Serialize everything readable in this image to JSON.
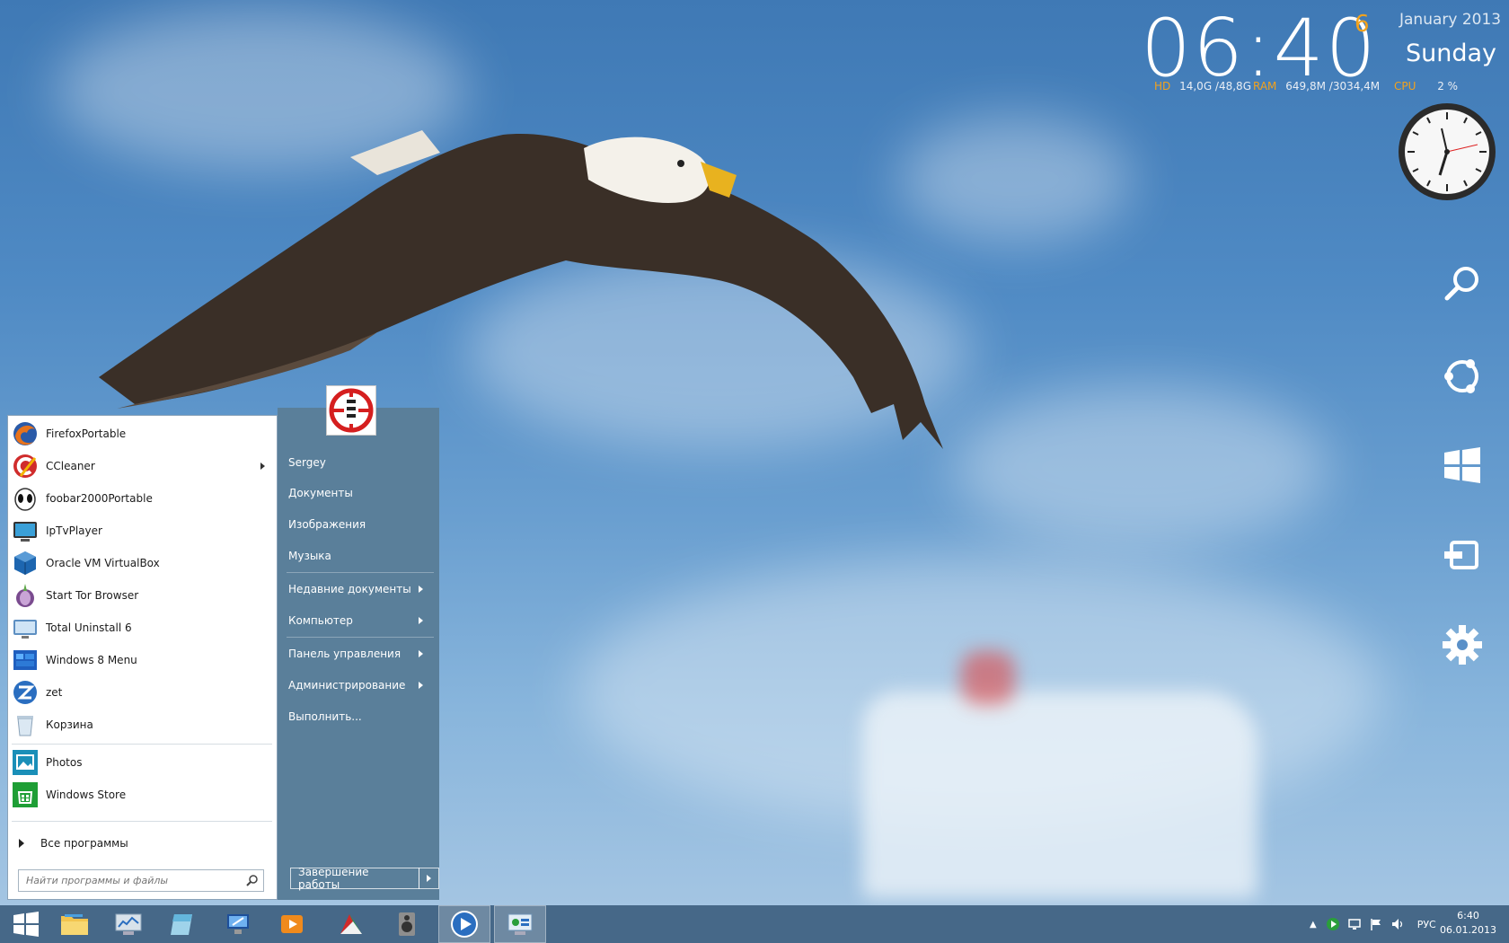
{
  "gadgets": {
    "time": "06:40",
    "day_number": "6",
    "month_year": "January 2013",
    "weekday": "Sunday",
    "hd_label": "HD",
    "hd_value": "14,0G /48,8G",
    "ram_label": "RAM",
    "ram_value": "649,8M /3034,4M",
    "cpu_label": "CPU",
    "cpu_value": "2 %",
    "accent_color": "#f3a21c"
  },
  "charms": [
    "search-icon",
    "share-icon",
    "start-icon",
    "devices-icon",
    "settings-icon"
  ],
  "start_menu": {
    "programs": [
      {
        "label": "FirefoxPortable",
        "icon": "firefox-icon",
        "submenu": false
      },
      {
        "label": "CCleaner",
        "icon": "ccleaner-icon",
        "submenu": true
      },
      {
        "label": "foobar2000Portable",
        "icon": "foobar-icon",
        "submenu": false
      },
      {
        "label": "IpTvPlayer",
        "icon": "tv-icon",
        "submenu": false
      },
      {
        "label": "Oracle VM VirtualBox",
        "icon": "virtualbox-icon",
        "submenu": false
      },
      {
        "label": "Start Tor Browser",
        "icon": "tor-icon",
        "submenu": false
      },
      {
        "label": "Total Uninstall 6",
        "icon": "uninstall-icon",
        "submenu": false
      },
      {
        "label": "Windows 8 Menu",
        "icon": "win8menu-icon",
        "submenu": false
      },
      {
        "label": "zet",
        "icon": "zet-icon",
        "submenu": false
      },
      {
        "label": "Корзина",
        "icon": "recycle-bin-icon",
        "submenu": false
      },
      {
        "label": "Photos",
        "icon": "photos-icon",
        "submenu": false
      },
      {
        "label": "Windows Store",
        "icon": "store-icon",
        "submenu": false
      }
    ],
    "all_programs": "Все программы",
    "search_placeholder": "Найти программы и файлы",
    "places": [
      {
        "label": "Sergey",
        "submenu": false
      },
      {
        "label": "Документы",
        "submenu": false
      },
      {
        "label": "Изображения",
        "submenu": false
      },
      {
        "label": "Музыка",
        "submenu": false
      },
      {
        "label": "Недавние документы",
        "submenu": true
      },
      {
        "label": "Компьютер",
        "submenu": true
      },
      {
        "label": "Панель управления",
        "submenu": true
      },
      {
        "label": "Администрирование",
        "submenu": true
      },
      {
        "label": "Выполнить...",
        "submenu": false
      }
    ],
    "shutdown_label": "Завершение работы"
  },
  "taskbar": {
    "pinned": [
      "start-button",
      "explorer-icon",
      "system-monitor-icon",
      "notepad-icon",
      "network-icon",
      "media-icon",
      "chart-icon",
      "speaker-icon",
      "player-icon",
      "control-panel-icon"
    ],
    "language": "РУС",
    "clock_time": "6:40",
    "clock_date": "06.01.2013"
  }
}
